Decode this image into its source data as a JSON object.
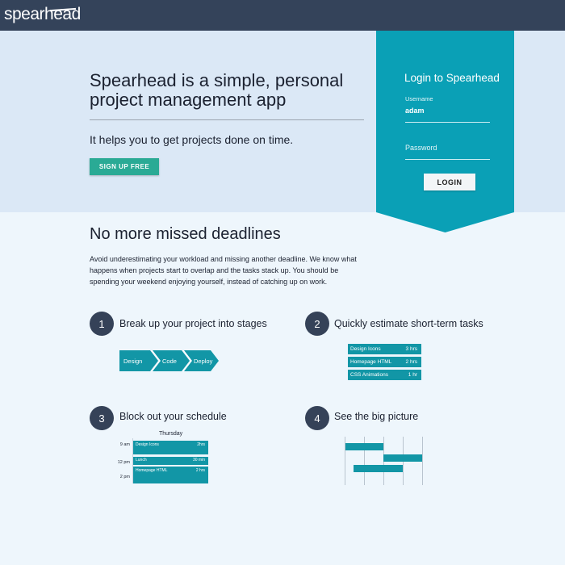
{
  "app": {
    "logo": "spearhead"
  },
  "hero": {
    "title": "Spearhead is a simple, personal project management app",
    "subtitle": "It helps you to get projects done on time.",
    "signup_label": "SIGN UP FREE"
  },
  "login": {
    "title": "Login to Spearhead",
    "username_label": "Username",
    "username_value": "adam",
    "password_placeholder": "Password",
    "login_label": "LOGIN"
  },
  "section": {
    "title": "No more missed deadlines",
    "body": "Avoid underestimating your workload and missing another deadline. We know what happens when projects start to overlap and the tasks stack up. You should be spending your weekend enjoying yourself, instead of catching up on work."
  },
  "steps": [
    {
      "number": "1",
      "title": "Break up your project into stages"
    },
    {
      "number": "2",
      "title": "Quickly estimate short-term tasks"
    },
    {
      "number": "3",
      "title": "Block out your schedule"
    },
    {
      "number": "4",
      "title": "See the big picture"
    }
  ],
  "stages": [
    "Design",
    "Code",
    "Deploy"
  ],
  "tasks": [
    {
      "name": "Design Icons",
      "hours": "3 hrs"
    },
    {
      "name": "Homepage HTML",
      "hours": "2 hrs"
    },
    {
      "name": "CSS Animations",
      "hours": "1 hr"
    }
  ],
  "schedule": {
    "day": "Thursday",
    "times": [
      "9 am",
      "12 pm",
      "2 pm"
    ],
    "events": [
      {
        "name": "Design Icons",
        "duration": "2hrs"
      },
      {
        "name": "Lunch",
        "duration": "30 min"
      },
      {
        "name": "Homepage HTML",
        "duration": "2 hrs"
      }
    ]
  },
  "colors": {
    "topbar": "#34435a",
    "hero_bg": "#dbe8f6",
    "accent_teal": "#0aa0b6",
    "signup_green": "#2aaa95",
    "step_circle": "#354258",
    "chart_teal": "#1296a6"
  }
}
